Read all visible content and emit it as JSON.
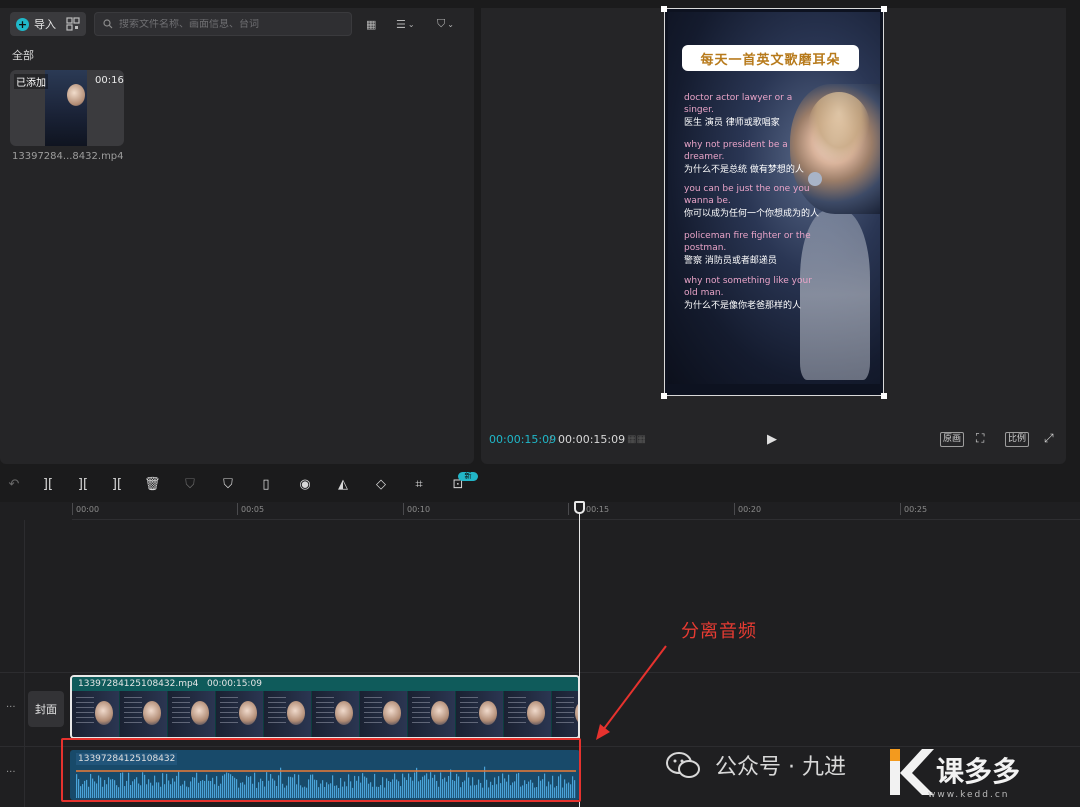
{
  "media_panel": {
    "import_label": "导入",
    "search_placeholder": "搜索文件名称、画面信息、台词",
    "filter_all_label": "全部",
    "item": {
      "added_badge": "已添加",
      "duration": "00:16",
      "filename": "13397284...8432.mp4"
    }
  },
  "preview": {
    "title_banner": "每天一首英文歌磨耳朵",
    "lyrics": [
      {
        "en": "doctor actor lawyer or a singer.",
        "zh": "医生 演员 律师或歌唱家"
      },
      {
        "en": "why not president be a dreamer.",
        "zh": "为什么不是总统 做有梦想的人"
      },
      {
        "en": "you can be just the one you wanna be.",
        "zh": "你可以成为任何一个你想成为的人"
      },
      {
        "en": "policeman fire fighter or the postman.",
        "zh": "警察 消防员或者邮递员"
      },
      {
        "en": "why not something like your old man.",
        "zh": "为什么不是像你老爸那样的人"
      }
    ],
    "time_current": "00:00:15:09",
    "time_separator": "/",
    "time_total": "00:00:15:09",
    "btn_original": "原画",
    "btn_ratio": "比例"
  },
  "toolbar": {
    "new_badge": "新"
  },
  "timeline": {
    "ticks": [
      "00:00",
      "00:05",
      "00:10",
      "00:15",
      "00:20",
      "00:25"
    ],
    "cover_label": "封面",
    "video_clip_name": "13397284125108432.mp4",
    "video_clip_duration": "00:00:15:09",
    "audio_clip_name": "13397284125108432"
  },
  "annotation": {
    "text": "分离音频"
  },
  "watermark": {
    "text": "公众号 · 九进",
    "brand": "课多多",
    "url": "www.kedd.cn"
  },
  "colors": {
    "accent": "#1fb8c9",
    "annotation_red": "#e6322e",
    "video_track": "#0f5b5b",
    "audio_track": "#184a6a",
    "lyric_en": "#e9a4c8",
    "banner_text": "#b77a1b"
  }
}
